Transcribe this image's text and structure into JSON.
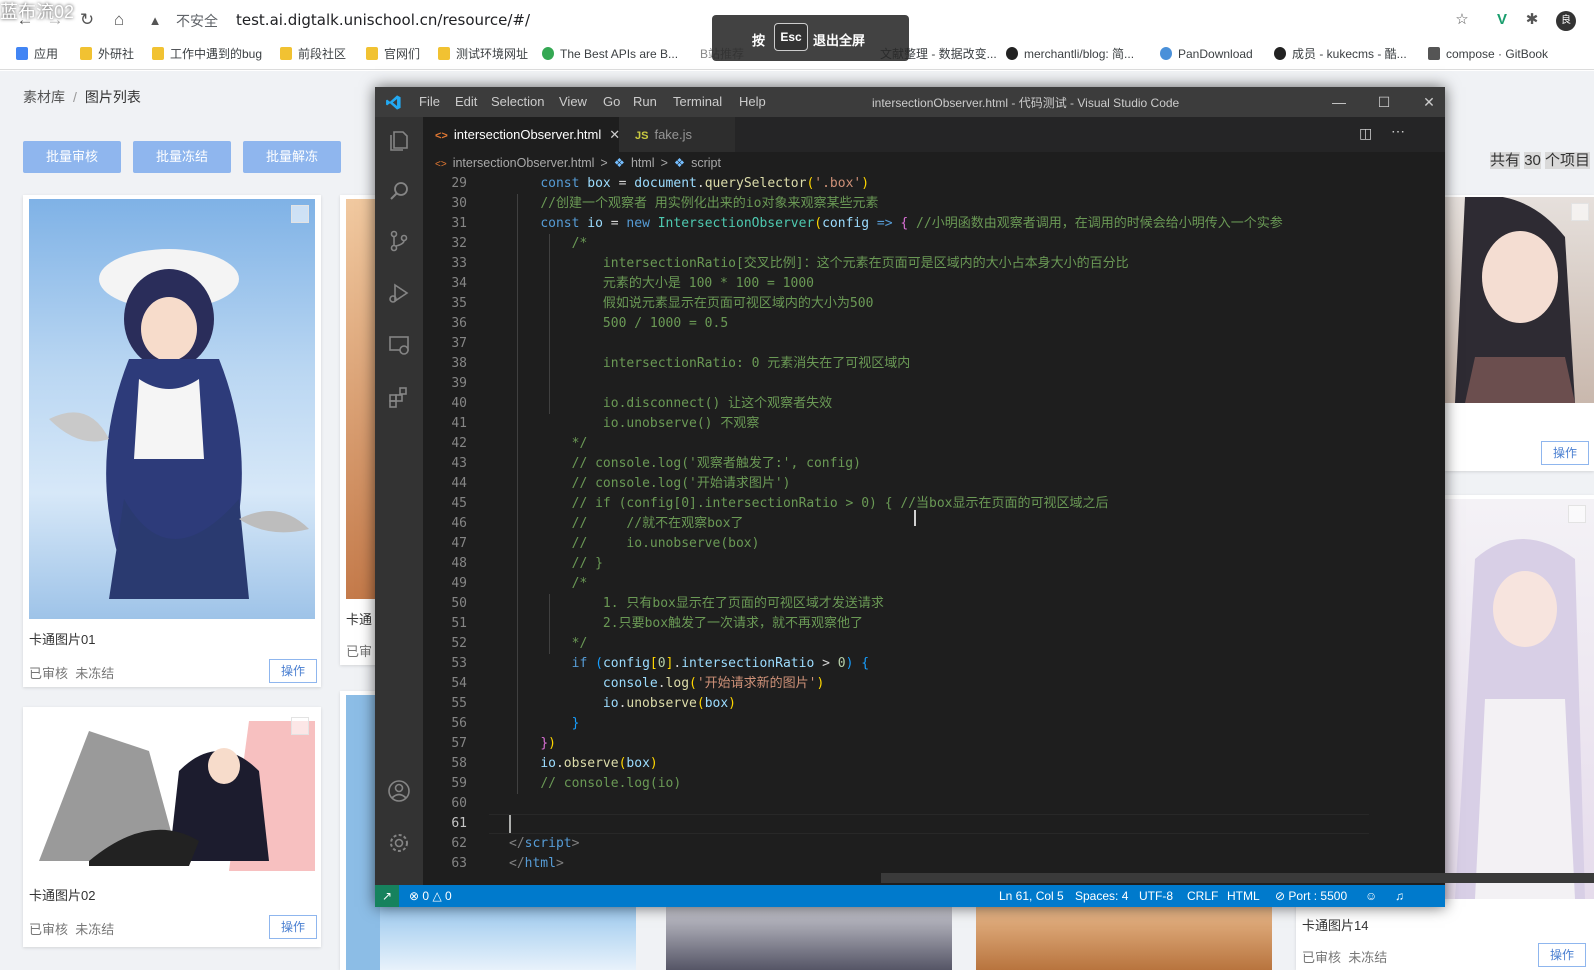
{
  "browser": {
    "watermark": "蓝布流02",
    "insecure_label": "不安全",
    "url": "test.ai.digtalk.unischool.cn/resource/#/",
    "bookmarks": [
      "应用",
      "外研社",
      "工作中遇到的bug",
      "前段社区",
      "官网们",
      "测试环境网址",
      "The Best APIs are B...",
      "B站推荐",
      "文献整理 - 数据改变...",
      "merchantli/blog: 简...",
      "PanDownload",
      "成员 - kukecms - 酷...",
      "compose · GitBook"
    ],
    "fullscreen_tip": {
      "prefix": "按",
      "key": "Esc",
      "suffix": "退出全屏"
    },
    "avatar_letter": "良"
  },
  "webpage": {
    "breadcrumb": [
      "素材库",
      "图片列表"
    ],
    "buttons": [
      "批量审核",
      "批量冻结",
      "批量解冻"
    ],
    "count_prefix": "共有",
    "count_number": "30",
    "count_suffix": "个项目",
    "cards": [
      {
        "title": "卡通图片01",
        "status1": "已审核",
        "status2": "未冻结",
        "op": "操作"
      },
      {
        "title": "卡通图片02",
        "status1": "已审核",
        "status2": "未冻结",
        "op": "操作"
      },
      {
        "title": "卡通图片14",
        "status1": "已审核",
        "status2": "未冻结",
        "op": "操作"
      }
    ],
    "partial_title": "卡通",
    "partial_status": "已审",
    "right_op": "操作"
  },
  "vscode": {
    "menu": [
      "File",
      "Edit",
      "Selection",
      "View",
      "Go",
      "Run",
      "Terminal",
      "Help"
    ],
    "window_title": "intersectionObserver.html - 代码测试 - Visual Studio Code",
    "tabs": [
      {
        "label": "intersectionObserver.html",
        "icon": "<>",
        "active": true
      },
      {
        "label": "fake.js",
        "icon": "JS",
        "active": false
      }
    ],
    "breadcrumbs": [
      "intersectionObserver.html",
      ">",
      "html",
      ">",
      "script"
    ],
    "status": {
      "errors": "0",
      "warnings": "0",
      "position": "Ln 61, Col 5",
      "spaces": "Spaces: 4",
      "encoding": "UTF-8",
      "eol": "CRLF",
      "language": "HTML",
      "port": "Port : 5500"
    },
    "code_lines": [
      {
        "n": "29",
        "html": "    <span class=\"kw\">const</span> <span class=\"vr\">box</span> = <span class=\"vr\">document</span>.<span class=\"fn\">querySelector</span><span class=\"br1\">(</span><span class=\"st-s\">'.box'</span><span class=\"br1\">)</span>"
      },
      {
        "n": "30",
        "html": "    <span class=\"cm\">//创建一个观察者 用实例化出来的io对象来观察某些元素</span>"
      },
      {
        "n": "31",
        "html": "    <span class=\"kw\">const</span> <span class=\"vr\">io</span> = <span class=\"kw\">new</span> <span class=\"cl\">IntersectionObserver</span><span class=\"br1\">(</span><span class=\"vr\">config</span> <span class=\"kw\">=&gt;</span> <span class=\"br2\">{</span> <span class=\"cm\">//小明函数由观察者调用，在调用的时候会给小明传入一个实参</span>"
      },
      {
        "n": "32",
        "html": "        <span class=\"cm\">/*</span>"
      },
      {
        "n": "33",
        "html": "<span class=\"cm\">            intersectionRatio[交叉比例]：这个元素在页面可是区域内的大小占本身大小的百分比</span>"
      },
      {
        "n": "34",
        "html": "<span class=\"cm\">            元素的大小是 100 * 100 = 1000</span>"
      },
      {
        "n": "35",
        "html": "<span class=\"cm\">            假如说元素显示在页面可视区域内的大小为500</span>"
      },
      {
        "n": "36",
        "html": "<span class=\"cm\">            500 / 1000 = 0.5</span>"
      },
      {
        "n": "37",
        "html": ""
      },
      {
        "n": "38",
        "html": "<span class=\"cm\">            intersectionRatio: 0 元素消失在了可视区域内</span>"
      },
      {
        "n": "39",
        "html": ""
      },
      {
        "n": "40",
        "html": "<span class=\"cm\">            io.disconnect() 让这个观察者失效</span>"
      },
      {
        "n": "41",
        "html": "<span class=\"cm\">            io.unobserve() 不观察</span>"
      },
      {
        "n": "42",
        "html": "<span class=\"cm\">        */</span>"
      },
      {
        "n": "43",
        "html": "        <span class=\"cm\">// console.log('观察者触发了:', config)</span>"
      },
      {
        "n": "44",
        "html": "        <span class=\"cm\">// console.log('开始请求图片')</span>"
      },
      {
        "n": "45",
        "html": "        <span class=\"cm\">// if (config[0].intersectionRatio &gt; 0) { //当box显示在页面的可视区域之后</span>"
      },
      {
        "n": "46",
        "html": "        <span class=\"cm\">//     //就不在观察box了</span>"
      },
      {
        "n": "47",
        "html": "        <span class=\"cm\">//     io.unobserve(box)</span>"
      },
      {
        "n": "48",
        "html": "        <span class=\"cm\">// }</span>"
      },
      {
        "n": "49",
        "html": "        <span class=\"cm\">/*</span>"
      },
      {
        "n": "50",
        "html": "<span class=\"cm\">            1. 只有box显示在了页面的可视区域才发送请求</span>"
      },
      {
        "n": "51",
        "html": "<span class=\"cm\">            2.只要box触发了一次请求，就不再观察他了</span>"
      },
      {
        "n": "52",
        "html": "<span class=\"cm\">        */</span>"
      },
      {
        "n": "53",
        "html": "        <span class=\"kw\">if</span> <span class=\"br3\">(</span><span class=\"vr\">config</span><span class=\"br1\">[</span><span class=\"nm\">0</span><span class=\"br1\">]</span>.<span class=\"vr\">intersectionRatio</span> &gt; <span class=\"nm\">0</span><span class=\"br3\">)</span> <span class=\"br3\">{</span>"
      },
      {
        "n": "54",
        "html": "            <span class=\"vr\">console</span>.<span class=\"fn\">log</span><span class=\"br1\">(</span><span class=\"st-s\">'开始请求新的图片'</span><span class=\"br1\">)</span>"
      },
      {
        "n": "55",
        "html": "            <span class=\"vr\">io</span>.<span class=\"fn\">unobserve</span><span class=\"br1\">(</span><span class=\"vr\">box</span><span class=\"br1\">)</span>"
      },
      {
        "n": "56",
        "html": "        <span class=\"br3\">}</span>"
      },
      {
        "n": "57",
        "html": "    <span class=\"br2\">}</span><span class=\"br1\">)</span>"
      },
      {
        "n": "58",
        "html": "    <span class=\"vr\">io</span>.<span class=\"fn\">observe</span><span class=\"br1\">(</span><span class=\"vr\">box</span><span class=\"br1\">)</span>"
      },
      {
        "n": "59",
        "html": "    <span class=\"cm\">// console.log(io)</span>"
      },
      {
        "n": "60",
        "html": ""
      },
      {
        "n": "61",
        "html": ""
      },
      {
        "n": "62",
        "html": "<span class=\"pu\">&lt;/</span><span class=\"tg\">script</span><span class=\"pu\">&gt;</span>"
      },
      {
        "n": "63",
        "html": "<span class=\"pu\">&lt;/</span><span class=\"tg\">html</span><span class=\"pu\">&gt;</span>"
      }
    ]
  },
  "colors": {
    "vscode_blue": "#007acc",
    "editor_bg": "#1e1e1e",
    "page_button": "#8fb6ee"
  }
}
